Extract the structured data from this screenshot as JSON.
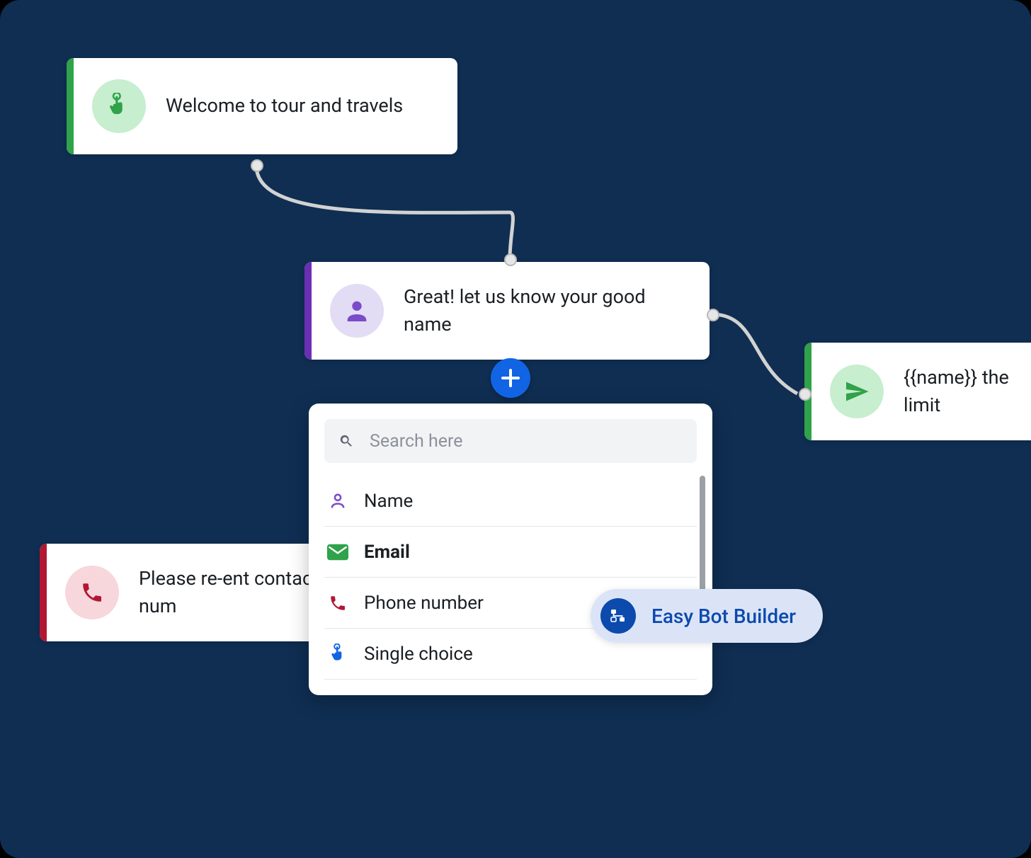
{
  "nodes": {
    "welcome": {
      "text": "Welcome to tour and travels",
      "accent": "#2fa24a"
    },
    "name": {
      "text": "Great! let us know your good name",
      "accent": "#6a2fb3"
    },
    "phone": {
      "text": "Please re-ent contact num",
      "accent": "#b11733"
    },
    "send": {
      "text": "{{name}} the limit ",
      "accent": "#2fa24a"
    }
  },
  "dropdown": {
    "search_placeholder": "Search here",
    "options": [
      {
        "key": "name",
        "label": "Name",
        "icon": "user-icon",
        "color": "#6a2fb3"
      },
      {
        "key": "email",
        "label": "Email",
        "icon": "mail-icon",
        "color": "#2fa24a",
        "active": true
      },
      {
        "key": "phone",
        "label": "Phone number",
        "icon": "phone-icon",
        "color": "#b11733"
      },
      {
        "key": "single",
        "label": "Single choice",
        "icon": "tap-icon",
        "color": "#1164e4"
      }
    ]
  },
  "pill": {
    "label": "Easy Bot Builder"
  }
}
